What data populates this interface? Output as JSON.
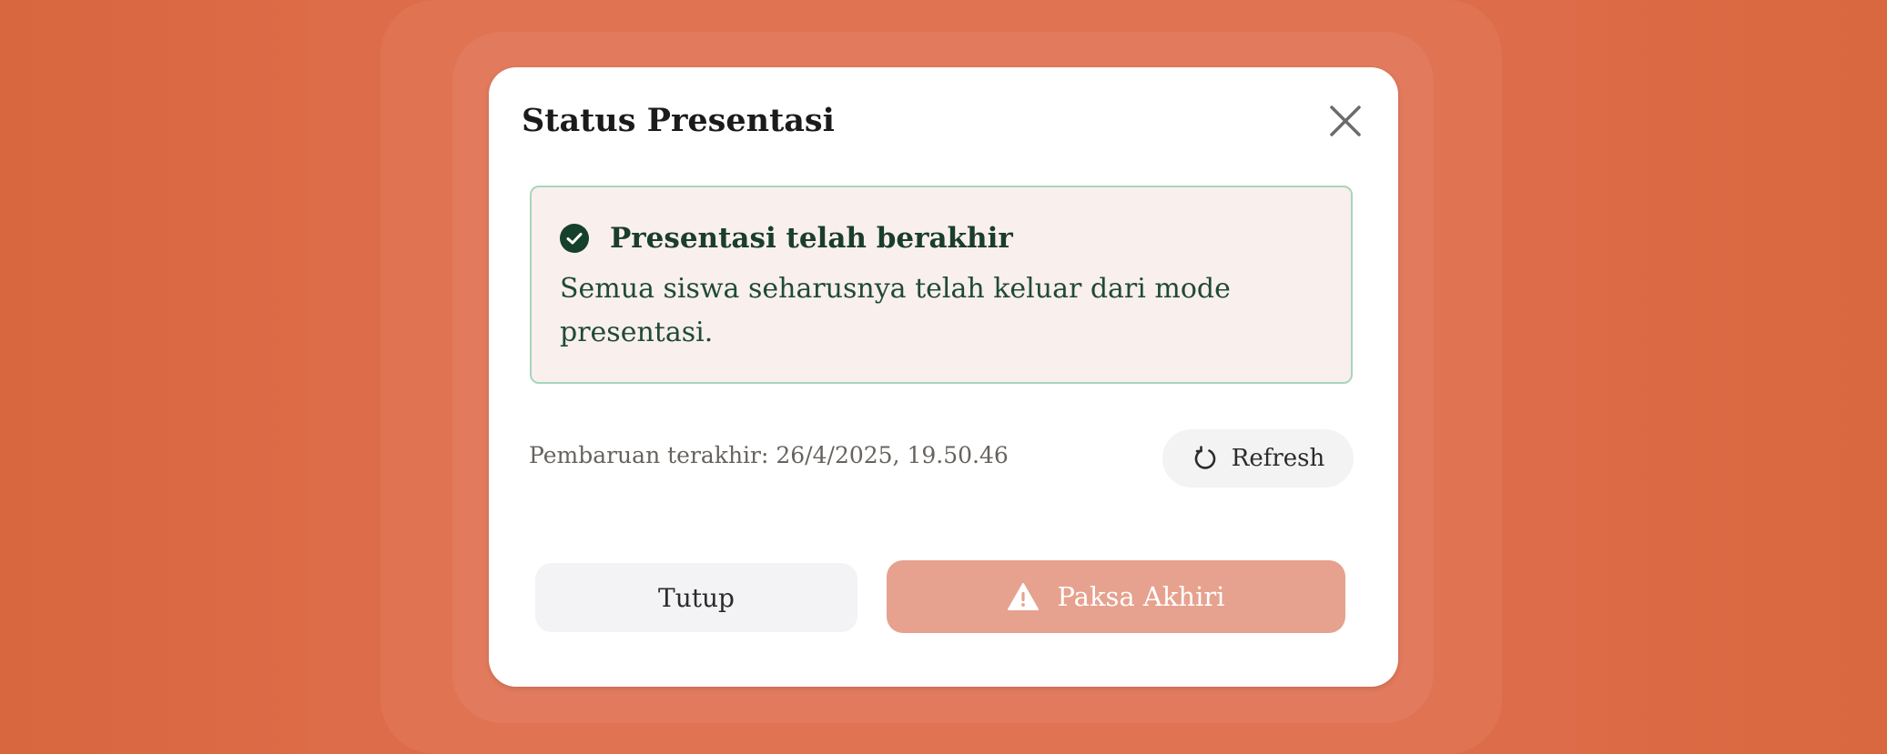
{
  "modal": {
    "title": "Status Presentasi",
    "close_icon": "close-icon"
  },
  "status": {
    "icon": "check-circle-icon",
    "title": "Presentasi telah berakhir",
    "description": "Semua siswa seharusnya telah keluar dari mode presentasi."
  },
  "update": {
    "last_updated": "Pembaruan terakhir: 26/4/2025, 19.50.46",
    "refresh_icon": "refresh-icon",
    "refresh_label": "Refresh"
  },
  "actions": {
    "close_label": "Tutup",
    "force_icon": "warning-icon",
    "force_label": "Paksa Akhiri"
  },
  "colors": {
    "background": "#d96845",
    "status_bg": "#f9efed",
    "status_border": "#a8d5bd",
    "status_text": "#1a3d2d",
    "force_button": "#e6a28e"
  }
}
